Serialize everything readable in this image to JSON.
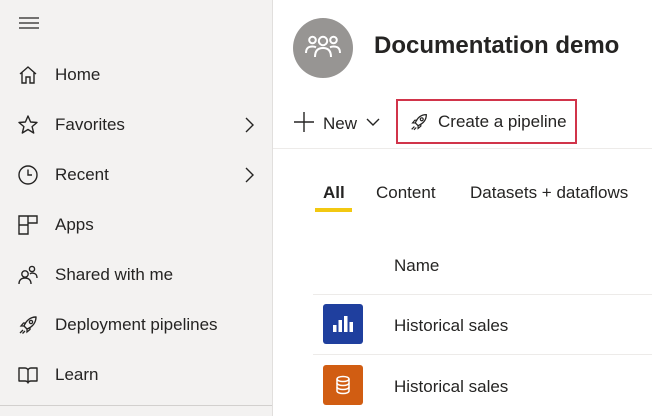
{
  "sidebar": {
    "items": [
      {
        "label": "Home",
        "icon": "home-icon"
      },
      {
        "label": "Favorites",
        "icon": "star-icon",
        "expandable": true
      },
      {
        "label": "Recent",
        "icon": "clock-icon",
        "expandable": true
      },
      {
        "label": "Apps",
        "icon": "apps-icon"
      },
      {
        "label": "Shared with me",
        "icon": "shared-icon"
      },
      {
        "label": "Deployment pipelines",
        "icon": "rocket-icon"
      },
      {
        "label": "Learn",
        "icon": "book-icon"
      }
    ]
  },
  "workspace": {
    "title": "Documentation demo",
    "avatar_icon": "group-icon"
  },
  "toolbar": {
    "new_label": "New",
    "create_pipeline_label": "Create a pipeline"
  },
  "tabs": [
    {
      "label": "All",
      "active": true
    },
    {
      "label": "Content",
      "active": false
    },
    {
      "label": "Datasets + dataflows",
      "active": false
    }
  ],
  "table": {
    "columns": [
      "Name"
    ],
    "rows": [
      {
        "name": "Historical sales",
        "type_icon": "report-icon",
        "color": "#1f3f9e"
      },
      {
        "name": "Historical sales",
        "type_icon": "dataset-icon",
        "color": "#d15d12"
      }
    ]
  },
  "colors": {
    "accent": "#f2c811",
    "highlight_border": "#d1344a",
    "sidebar_bg": "#f3f2f1"
  }
}
